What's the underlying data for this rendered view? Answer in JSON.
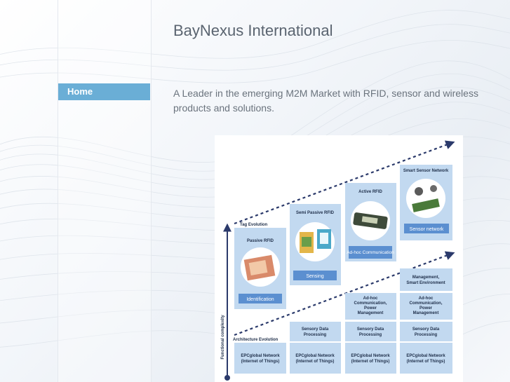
{
  "site": {
    "title": "BayNexus International"
  },
  "nav": {
    "items": [
      {
        "label": "Home"
      }
    ]
  },
  "main": {
    "tagline": "A Leader in the emerging M2M Market with RFID, sensor and wireless products and solutions."
  },
  "diagram": {
    "y_axis_label": "Functional complexity",
    "tag_evolution_label": "Tag Evolution",
    "architecture_label": "Architecture Evolution",
    "tags": [
      {
        "title": "Passive RFID",
        "badge": "Identification"
      },
      {
        "title": "Semi Passive RFID",
        "badge": "Sensing"
      },
      {
        "title": "Active RFID",
        "badge": "Ad-hoc Communication"
      },
      {
        "title": "Smart Sensor Network",
        "badge": "Sensor network"
      }
    ],
    "arch": {
      "network": [
        "EPCglobal Network",
        "(Internet of Things)"
      ],
      "processing": [
        "Sensory Data",
        "Processing"
      ],
      "adhoc": [
        "Ad-hoc",
        "Communication,",
        "Power",
        "Management"
      ],
      "management": [
        "Management,",
        "Smart Environment"
      ]
    },
    "colors": {
      "box": "#c2d9f0",
      "badge": "#5b8fd0",
      "arrow": "#2b3a6b"
    }
  }
}
